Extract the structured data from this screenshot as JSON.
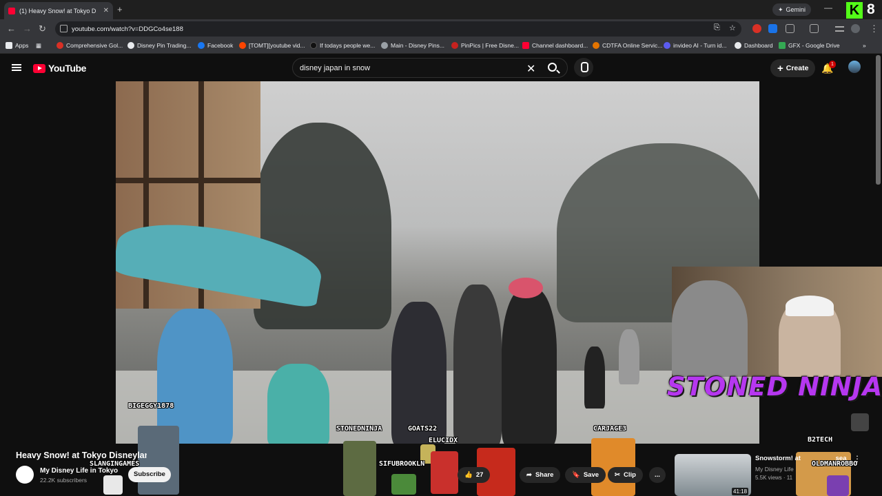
{
  "browser": {
    "tab_title": "(1) Heavy Snow! at Tokyo D",
    "new_tab": "+",
    "gemini_label": "Gemini",
    "kick_count": "8",
    "url": "youtube.com/watch?v=DDGCo4se188",
    "bookmarks": [
      {
        "label": "Apps",
        "color": "#e8eaed"
      },
      {
        "label": "Comprehensive Gol...",
        "color": "#d93025"
      },
      {
        "label": "Disney Pin Trading...",
        "color": "#e8eaed"
      },
      {
        "label": "Facebook",
        "color": "#1877f2"
      },
      {
        "label": "[TOMT][youtube vid...",
        "color": "#ff4500"
      },
      {
        "label": "If todays people we...",
        "color": "#000000"
      },
      {
        "label": "Main - Disney Pins...",
        "color": "#9aa0a6"
      },
      {
        "label": "PinPics | Free Disne...",
        "color": "#c5221f"
      },
      {
        "label": "Channel dashboard...",
        "color": "#ff0033"
      },
      {
        "label": "CDTFA Online Servic...",
        "color": "#e37400"
      },
      {
        "label": "invideo AI - Turn id...",
        "color": "#5b5bf0"
      },
      {
        "label": "Dashboard",
        "color": "#e8eaed"
      },
      {
        "label": "GFX - Google Drive",
        "color": "#34a853"
      }
    ]
  },
  "youtube": {
    "logo_text": "YouTube",
    "search_query": "disney japan in snow",
    "create_label": "Create",
    "notif_count": "1"
  },
  "video": {
    "title": "Heavy Snow! at Tokyo Disneyland",
    "channel": "My Disney Life in Tokyo",
    "subscribers": "22.2K subscribers",
    "subscribe_label": "Subscribe",
    "like_count": "27",
    "share_label": "Share",
    "save_label": "Save",
    "clip_label": "Clip",
    "more_label": "..."
  },
  "overlay": {
    "banner": "STONED NINJA",
    "names": [
      "BIGEGGY1878",
      "STONEDNINJA",
      "GOATS22",
      "ELUCIDX",
      "CARJAGE3",
      "B2TECH",
      "SLANGINGAMES",
      "SIFUBROOKLN",
      "OLDMANROBBO"
    ]
  },
  "recommended": {
    "title": "Snowstorm! at",
    "title_suffix": "sea",
    "channel": "My Disney Life",
    "views": "5.5K views · 11",
    "duration": "41:18"
  }
}
